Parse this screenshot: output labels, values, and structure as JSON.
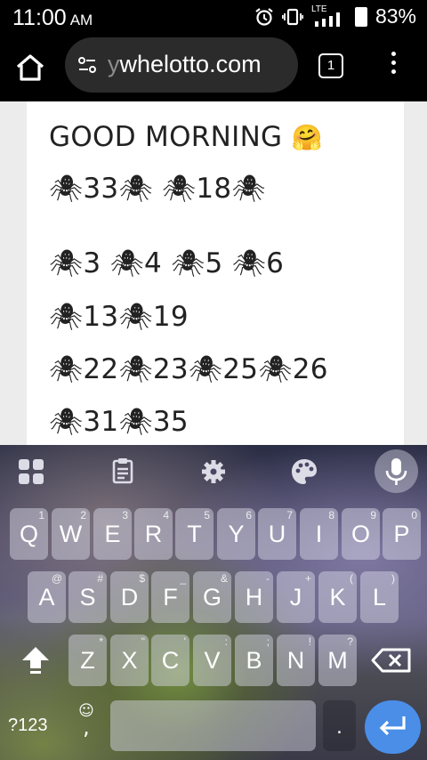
{
  "status": {
    "time": "11:00",
    "ampm": "AM",
    "network": "LTE",
    "battery": "83%"
  },
  "browser": {
    "url_dim": "y",
    "url": "whelotto.com",
    "tab_count": "1"
  },
  "page": {
    "greeting": "GOOD MORNING",
    "greeting_emoji": "🤗",
    "spider": "🕷",
    "lines": [
      [
        "33",
        "18"
      ],
      [
        "3",
        "4",
        "5",
        "6"
      ],
      [
        "13",
        "19"
      ],
      [
        "22",
        "23",
        "25",
        "26"
      ],
      [
        "31",
        "35"
      ]
    ]
  },
  "keyboard": {
    "row1": [
      {
        "k": "Q",
        "h": "1"
      },
      {
        "k": "W",
        "h": "2"
      },
      {
        "k": "E",
        "h": "3"
      },
      {
        "k": "R",
        "h": "4"
      },
      {
        "k": "T",
        "h": "5"
      },
      {
        "k": "Y",
        "h": "6"
      },
      {
        "k": "U",
        "h": "7"
      },
      {
        "k": "I",
        "h": "8"
      },
      {
        "k": "O",
        "h": "9"
      },
      {
        "k": "P",
        "h": "0"
      }
    ],
    "row2": [
      {
        "k": "A",
        "h": "@"
      },
      {
        "k": "S",
        "h": "#"
      },
      {
        "k": "D",
        "h": "$"
      },
      {
        "k": "F",
        "h": "_"
      },
      {
        "k": "G",
        "h": "&"
      },
      {
        "k": "H",
        "h": "-"
      },
      {
        "k": "J",
        "h": "+"
      },
      {
        "k": "K",
        "h": "("
      },
      {
        "k": "L",
        "h": ")"
      }
    ],
    "row3": [
      {
        "k": "Z",
        "h": "*"
      },
      {
        "k": "X",
        "h": "\""
      },
      {
        "k": "C",
        "h": "'"
      },
      {
        "k": "V",
        "h": ":"
      },
      {
        "k": "B",
        "h": ";"
      },
      {
        "k": "N",
        "h": "!"
      },
      {
        "k": "M",
        "h": "?"
      }
    ],
    "symbols_label": "?123",
    "comma": ",",
    "period": ".",
    "emoji_icon": "☺",
    "enter_color": "#4a8ee8"
  },
  "colors": {
    "status_bg": "#000000",
    "url_pill": "#2b2b2b",
    "page_bg": "#ffffff"
  },
  "icons": [
    "alarm-icon",
    "vibrate-icon",
    "signal-icon",
    "battery-icon",
    "home-icon",
    "site-info-icon",
    "tabs-icon",
    "overflow-menu-icon",
    "apps-grid-icon",
    "clipboard-icon",
    "settings-gear-icon",
    "palette-icon",
    "mic-icon",
    "shift-icon",
    "backspace-icon",
    "enter-icon"
  ]
}
